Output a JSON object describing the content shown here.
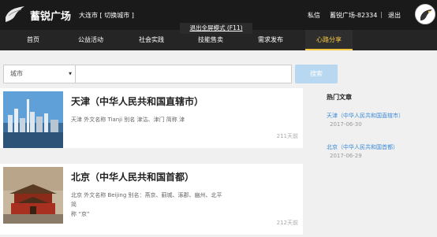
{
  "header": {
    "site_name": "蓄锐广场",
    "city": "大连市",
    "city_switch": "[ 切换城市 ]",
    "messages": "私信",
    "username": "蓄锐广场-82334",
    "separator": "|",
    "logout": "退出"
  },
  "fullscreen_tip": "退出全屏模式 (F11)",
  "nav": {
    "items": [
      {
        "label": "首页"
      },
      {
        "label": "公益活动"
      },
      {
        "label": "社会实践"
      },
      {
        "label": "技能售卖"
      },
      {
        "label": "需求发布"
      },
      {
        "label": "心路分享",
        "active": true
      }
    ]
  },
  "search": {
    "select_value": "城市",
    "input_value": "",
    "button_label": "搜索"
  },
  "articles": [
    {
      "title": "天津（中华人民共和国直辖市）",
      "description": "天津 外文名称 Tianji 别名 津沽、津门 简称 津",
      "date": "211天前"
    },
    {
      "title": "北京（中华人民共和国首都）",
      "description_line1": "北京 外文名称 Beijing 别名：燕京、蓟城、涿郡、幽州、北平 简",
      "description_line2": "称 “京”",
      "date": "212天前"
    }
  ],
  "sidebar": {
    "title": "热门文章",
    "items": [
      {
        "label": "天津（中华人民共和国直辖市）",
        "date": "2017-06-30"
      },
      {
        "label": "北京（中华人民共和国首都）",
        "date": "2017-06-29"
      }
    ]
  },
  "colors": {
    "header_bg": "#1a1a1a",
    "nav_bg": "#252525",
    "active": "#f5c842",
    "link": "#3a8ad8",
    "search_button": "#b7d8f0"
  }
}
